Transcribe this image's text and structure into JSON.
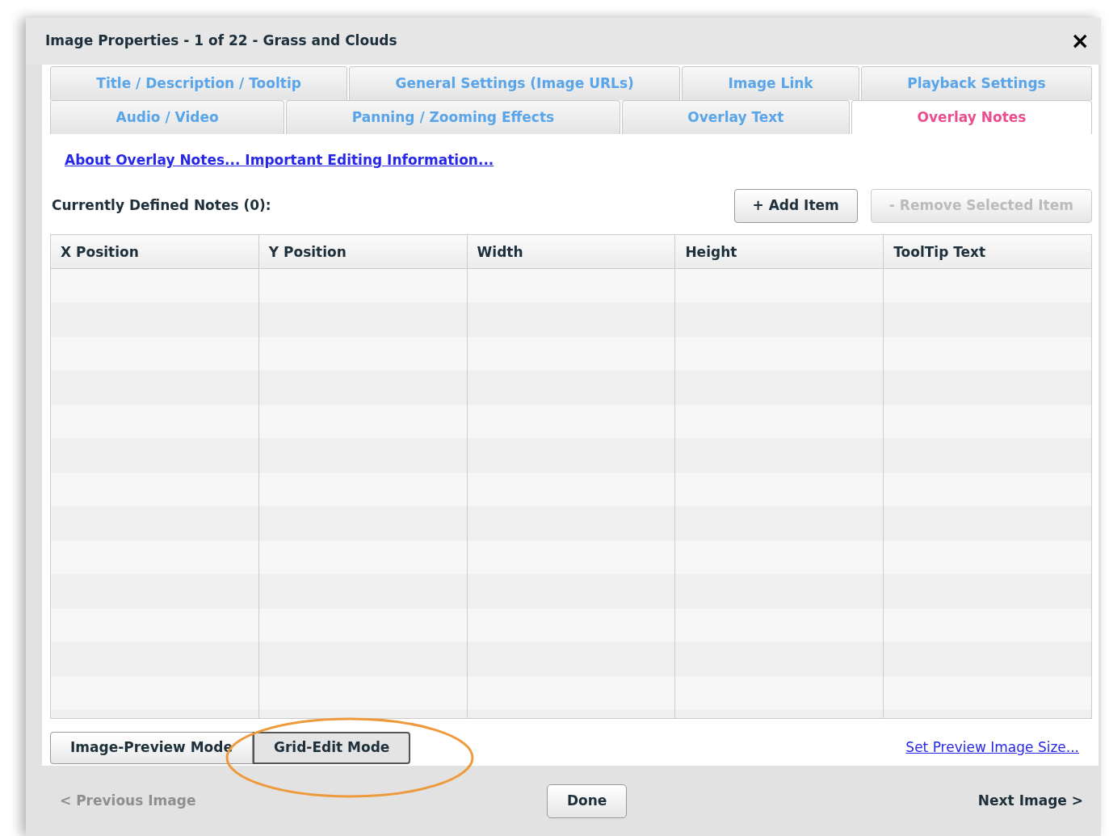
{
  "window": {
    "title": "Image Properties - 1 of 22 - Grass and Clouds",
    "close": "×"
  },
  "tab_rows": [
    [
      {
        "label": "Title / Description / Tooltip",
        "selected": false
      },
      {
        "label": "General Settings (Image URLs)",
        "selected": false
      },
      {
        "label": "Image Link",
        "selected": false
      },
      {
        "label": "Playback Settings",
        "selected": false
      }
    ],
    [
      {
        "label": "Audio / Video",
        "selected": false
      },
      {
        "label": "Panning / Zooming Effects",
        "selected": false
      },
      {
        "label": "Overlay Text",
        "selected": false
      },
      {
        "label": "Overlay Notes",
        "selected": true
      }
    ]
  ],
  "info_link": "About Overlay Notes... Important Editing Information...",
  "notes_label": "Currently Defined Notes (0):",
  "toolbar_buttons": [
    {
      "label": "+ Add Item",
      "disabled": false
    },
    {
      "label": "- Remove Selected Item",
      "disabled": true
    }
  ],
  "table": {
    "columns": [
      "X Position",
      "Y Position",
      "Width",
      "Height",
      "ToolTip Text"
    ]
  },
  "mode_buttons": [
    {
      "label": "Image-Preview Mode",
      "selected": false,
      "highlighted": false
    },
    {
      "label": "Grid-Edit Mode",
      "selected": true,
      "highlighted": true
    }
  ],
  "preview_size_link": "Set Preview Image Size...",
  "footer": {
    "previous": {
      "label": "< Previous Image",
      "disabled": true
    },
    "done": "Done",
    "next": {
      "label": "Next Image >",
      "disabled": false
    }
  }
}
